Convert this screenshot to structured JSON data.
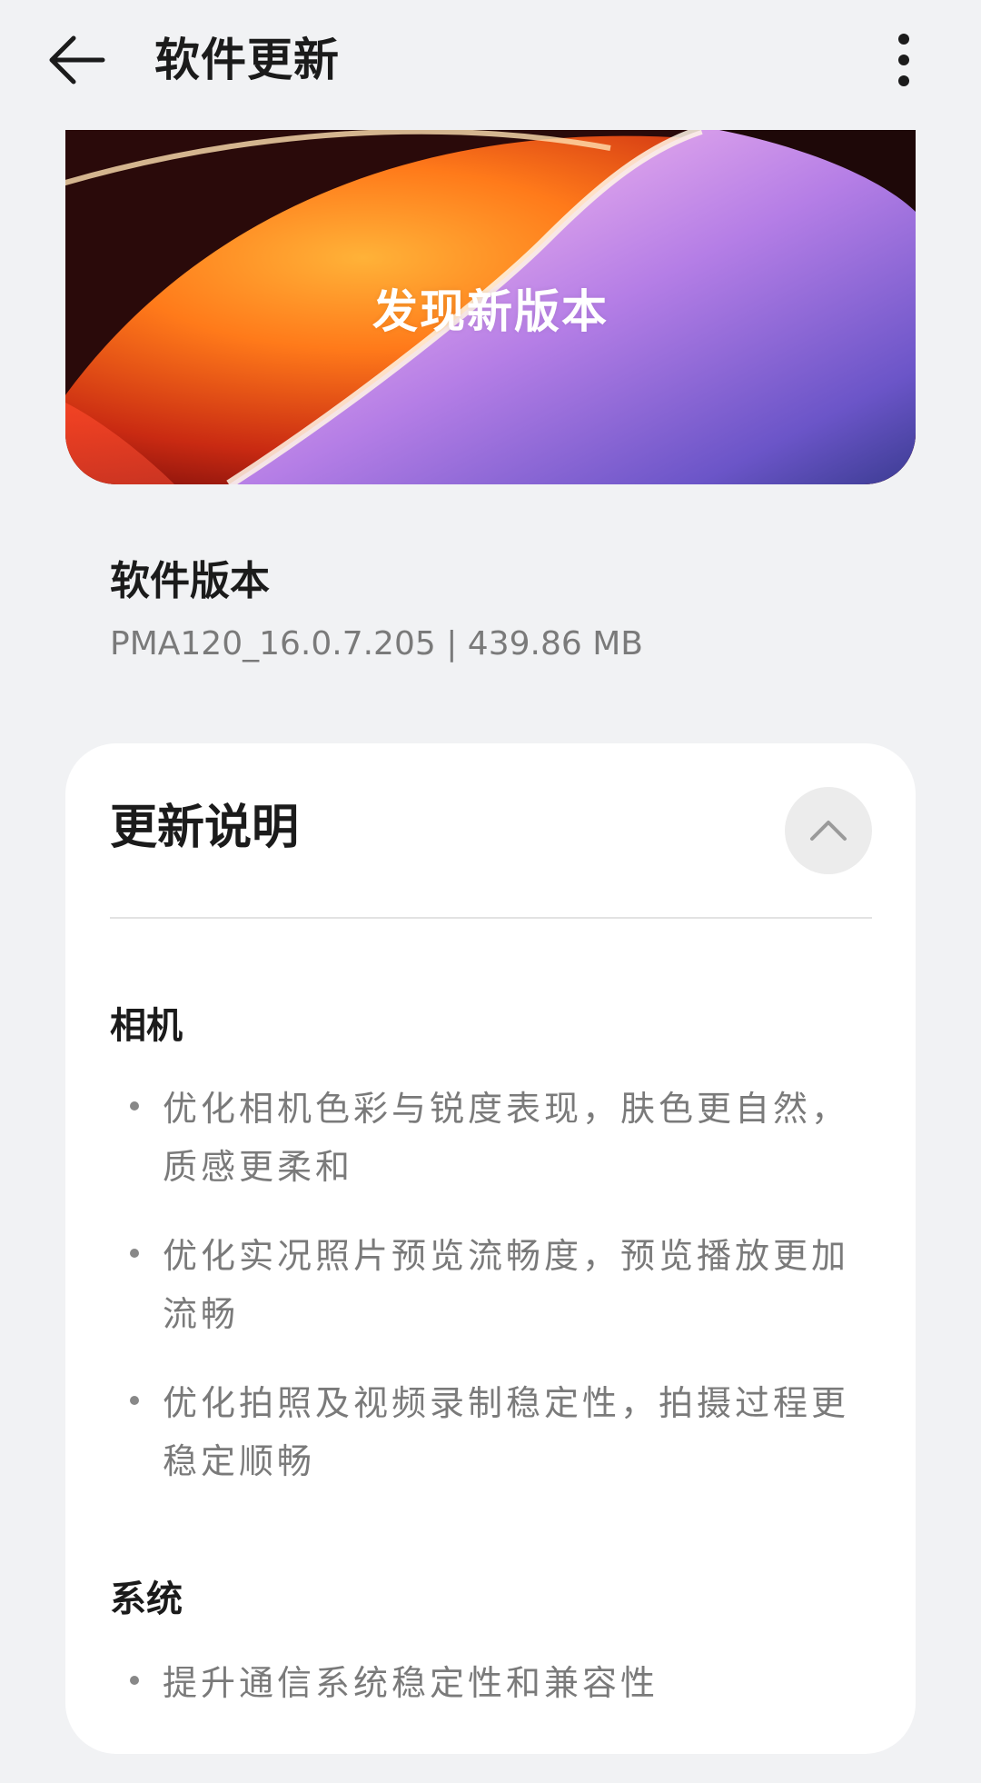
{
  "header": {
    "title": "软件更新",
    "back_icon": "arrow-left-icon",
    "more_icon": "more-vertical-icon"
  },
  "hero": {
    "text": "发现新版本",
    "colors": {
      "orange": "#ff7a1a",
      "dark_red": "#7a0d0b",
      "purple": "#b57ee6",
      "indigo": "#3b3c92"
    }
  },
  "version": {
    "label": "软件版本",
    "value": "PMA120_16.0.7.205 | 439.86 MB"
  },
  "release_notes": {
    "title": "更新说明",
    "collapse_icon": "chevron-up-icon",
    "sections": [
      {
        "title": "相机",
        "items": [
          "优化相机色彩与锐度表现，肤色更自然，质感更柔和",
          "优化实况照片预览流畅度，预览播放更加流畅",
          "优化拍照及视频录制稳定性，拍摄过程更稳定顺畅"
        ]
      },
      {
        "title": "系统",
        "items": [
          "提升通信系统稳定性和兼容性"
        ]
      }
    ]
  }
}
